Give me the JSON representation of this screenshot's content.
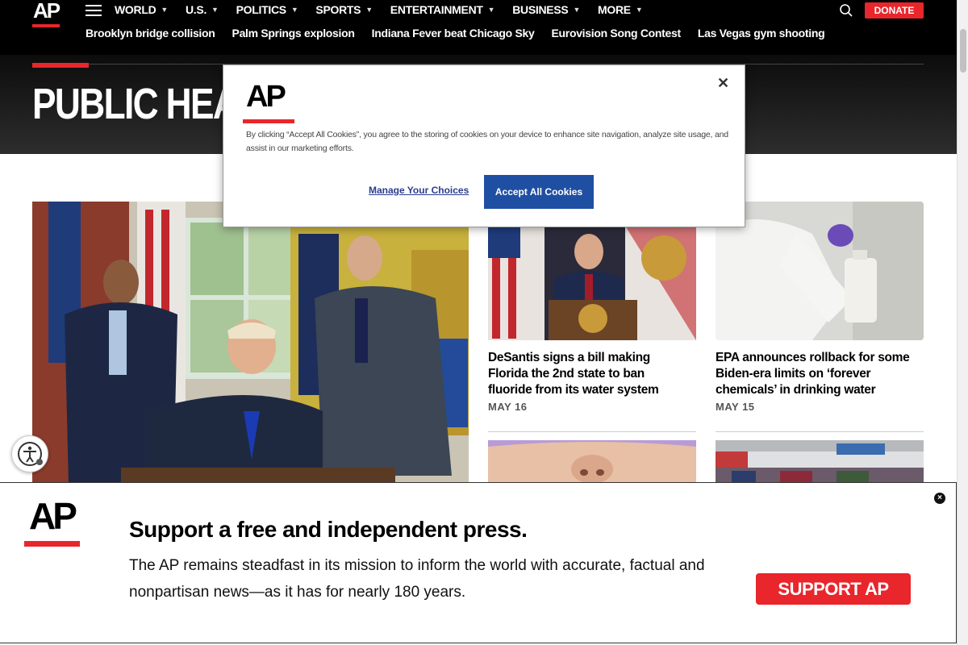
{
  "header": {
    "logo": "AP",
    "nav": [
      "WORLD",
      "U.S.",
      "POLITICS",
      "SPORTS",
      "ENTERTAINMENT",
      "BUSINESS",
      "MORE"
    ],
    "donate_label": "DONATE",
    "trending": [
      "Brooklyn bridge collision",
      "Palm Springs explosion",
      "Indiana Fever beat Chicago Sky",
      "Eurovision Song Contest",
      "Las Vegas gym shooting"
    ]
  },
  "hero": {
    "title": "PUBLIC HEA"
  },
  "stories": [
    {
      "headline": "DeSantis signs a bill making Florida the 2nd state to ban fluoride from its water system",
      "date": "MAY 16"
    },
    {
      "headline": "EPA announces rollback for some Biden-era limits on ‘forever chemicals’ in drinking water",
      "date": "MAY 15"
    }
  ],
  "cookie_modal": {
    "logo": "AP",
    "close_label": "✕",
    "text": "By clicking “Accept All Cookies”, you agree to the storing of cookies on your device to enhance site navigation, analyze site usage, and assist in our marketing efforts.",
    "manage_label": "Manage Your Choices",
    "accept_label": "Accept All Cookies"
  },
  "banner": {
    "logo": "AP",
    "headline": "Support a free and independent press.",
    "body": "The AP remains steadfast in its mission to inform the world with accurate, factual and nonpartisan news—as it has for nearly 180 years.",
    "support_label": "SUPPORT AP",
    "close_label": "×"
  },
  "colors": {
    "accent": "#e8262c",
    "button_blue": "#1f4fa3"
  }
}
